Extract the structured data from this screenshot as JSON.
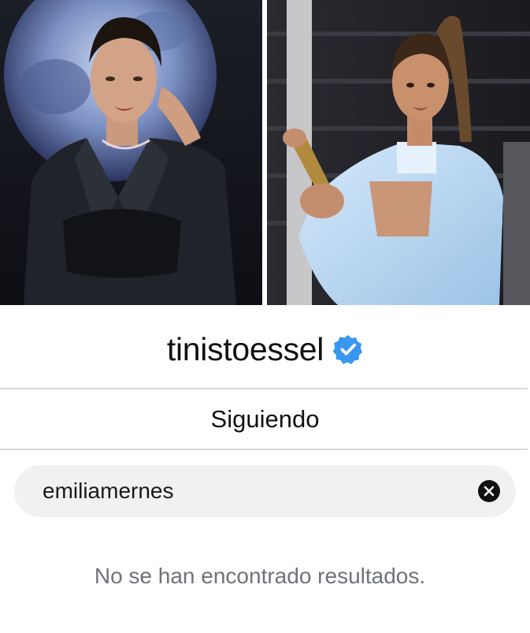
{
  "profile": {
    "username": "tinistoessel",
    "verified": true,
    "verified_color": "#3897f0",
    "photos": [
      {
        "subject": "woman in black blazer and lace top before moon backdrop"
      },
      {
        "subject": "woman with high ponytail in light blue cropped jacket holding trophy"
      }
    ]
  },
  "section": {
    "title": "Siguiendo"
  },
  "search": {
    "value": "emiliamernes",
    "clear_icon": "close-circle-icon"
  },
  "results": {
    "empty_message": "No se han encontrado resultados."
  }
}
